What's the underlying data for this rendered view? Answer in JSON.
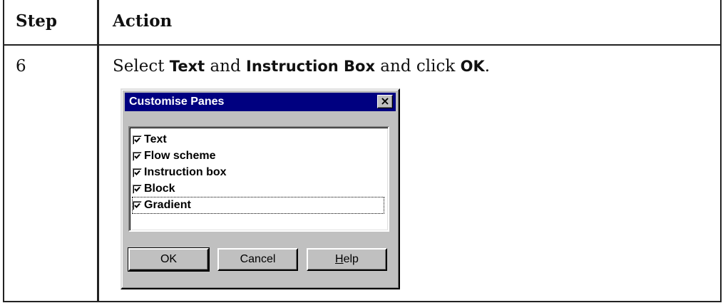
{
  "table": {
    "header_step": "Step",
    "header_action": "Action",
    "row": {
      "step": "6",
      "instruction_parts": {
        "pre": "Select ",
        "bold1": "Text",
        "mid1": " and ",
        "bold2": "Instruction Box",
        "mid2": " and click ",
        "bold3": "OK",
        "post": "."
      }
    }
  },
  "dialog": {
    "title": "Customise Panes",
    "close_label": "×",
    "items": [
      {
        "label": "Text",
        "checked": true
      },
      {
        "label": "Flow scheme",
        "checked": true
      },
      {
        "label": "Instruction box",
        "checked": true
      },
      {
        "label": "Block",
        "checked": true
      },
      {
        "label": "Gradient",
        "checked": true,
        "focused": true
      }
    ],
    "buttons": {
      "ok": "OK",
      "cancel": "Cancel",
      "help": "Help"
    }
  }
}
